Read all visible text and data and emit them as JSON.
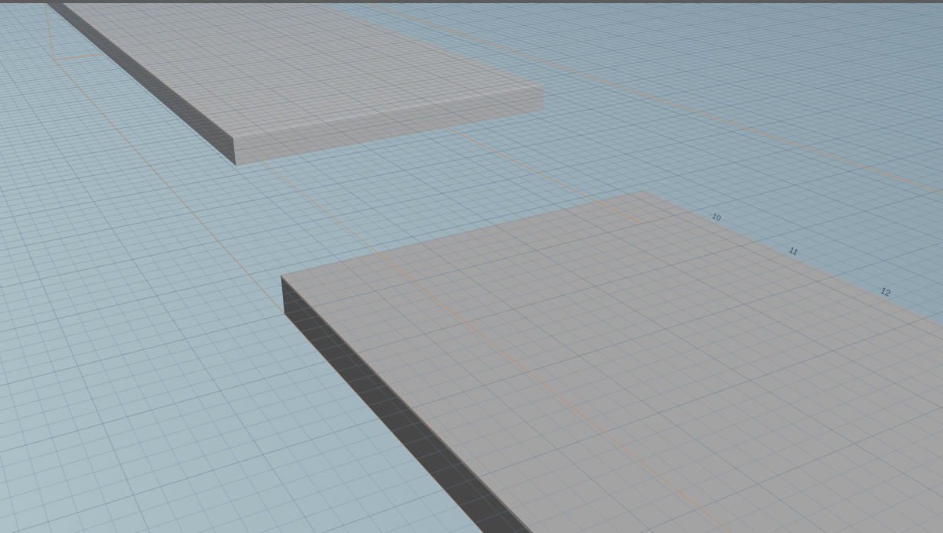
{
  "viewport": {
    "ruler_labels": [
      "10",
      "11",
      "12"
    ]
  }
}
